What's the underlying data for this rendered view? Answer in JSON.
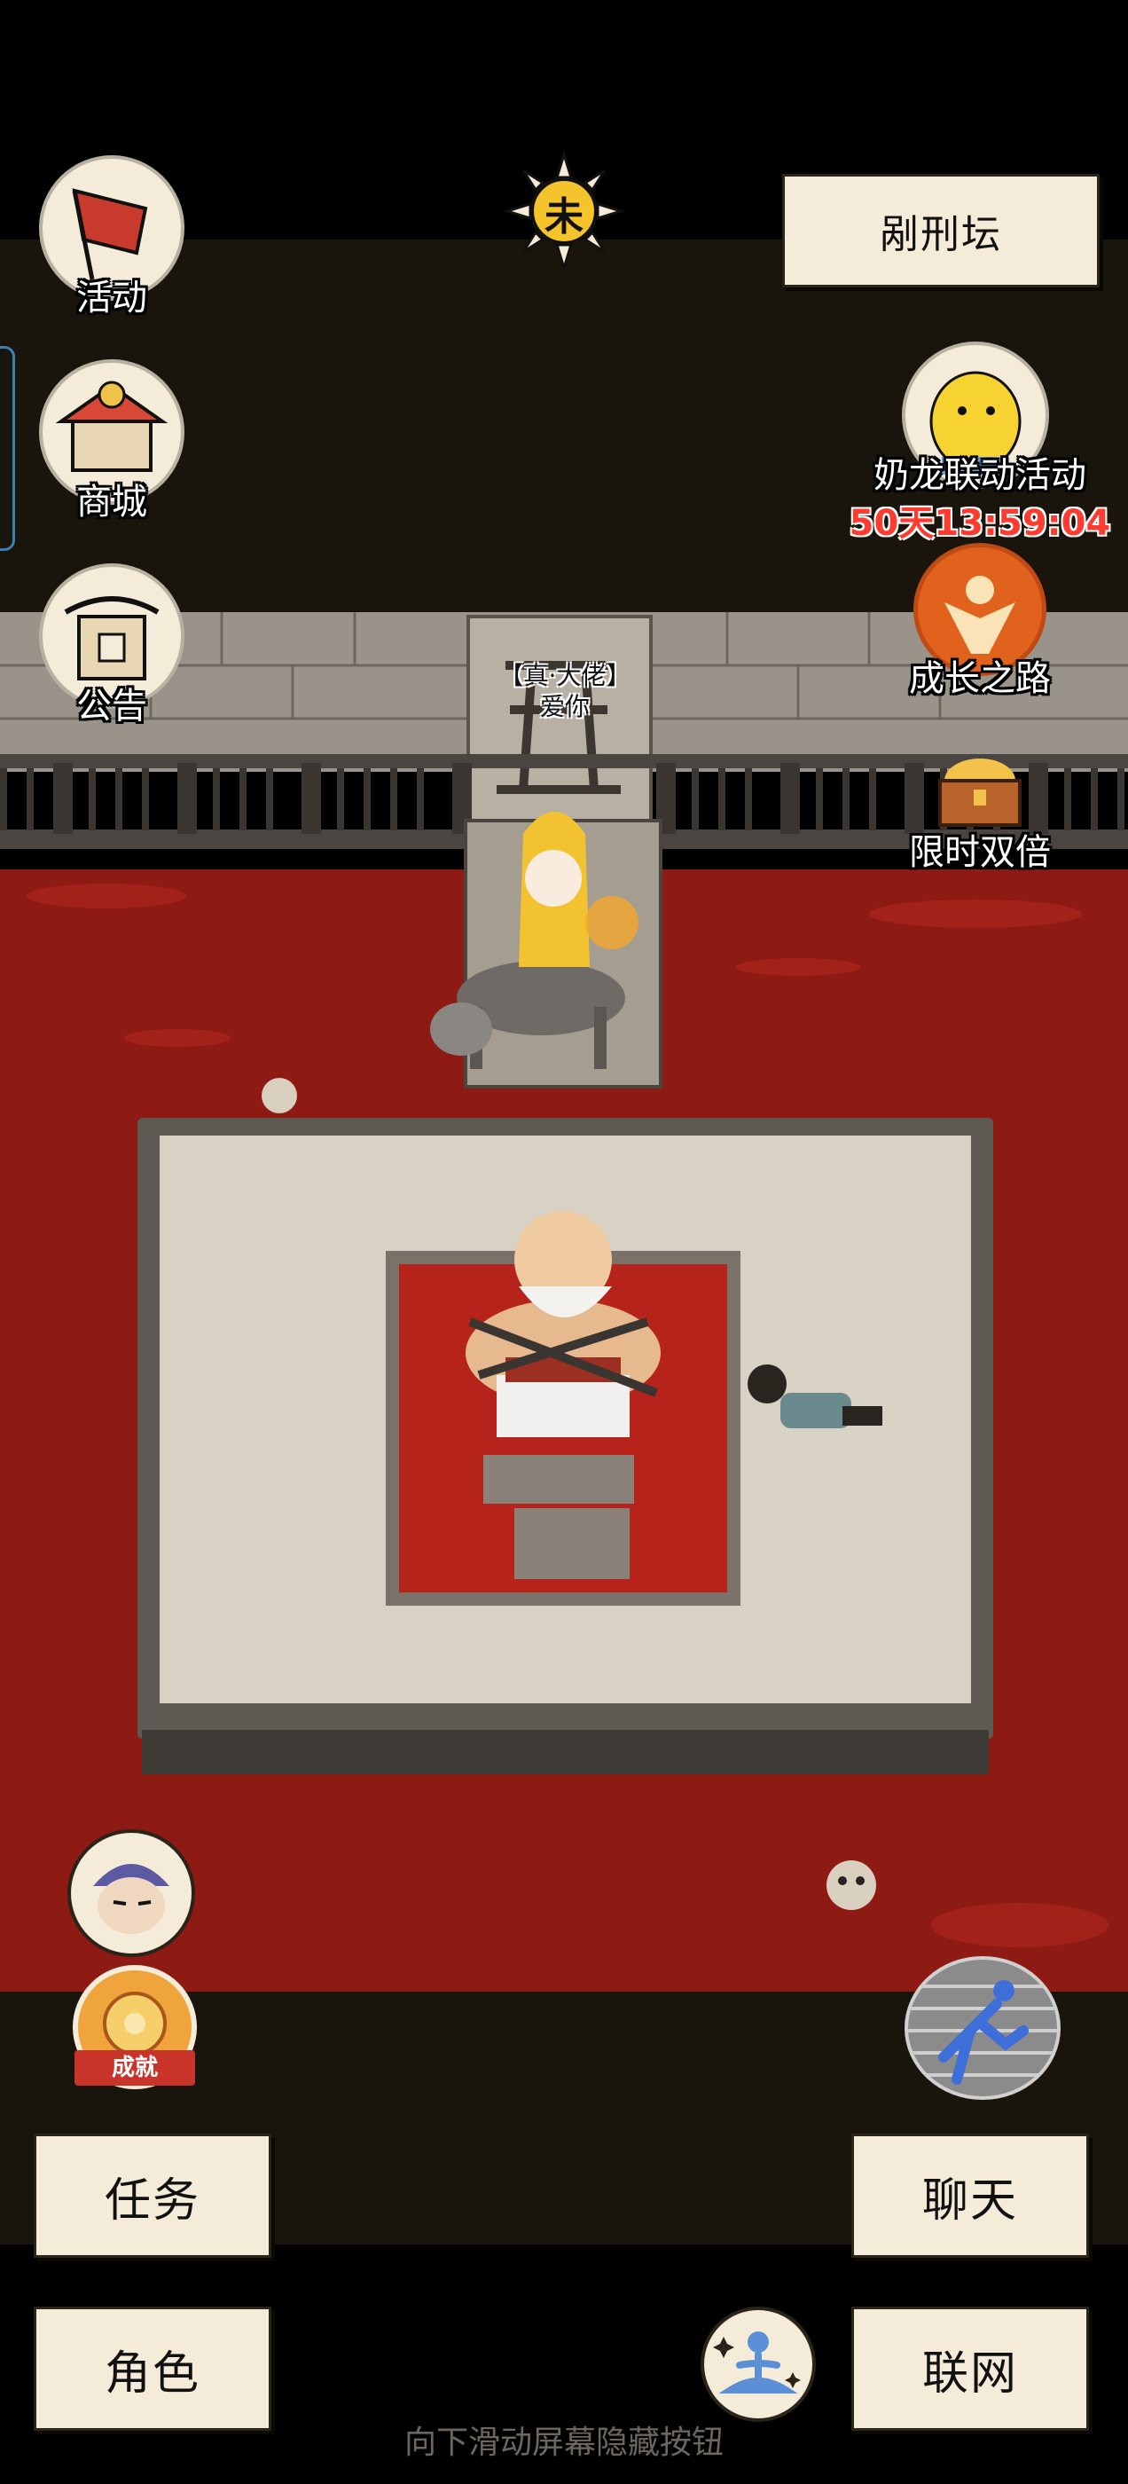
{
  "hud": {
    "time_glyph": "未",
    "location_label": "剐刑坛",
    "left_menu": [
      {
        "label": "活动",
        "icon": "flag-icon"
      },
      {
        "label": "商城",
        "icon": "shop-icon"
      },
      {
        "label": "公告",
        "icon": "notice-board-icon"
      }
    ],
    "right_menu": {
      "collab_label": "奶龙联动活动",
      "collab_timer": "50天13:59:04",
      "growth_label": "成长之路",
      "double_label": "限时双倍"
    },
    "achievement_badge_text": "成就",
    "swipe_hint": "向下滑动屏幕隐藏按钮"
  },
  "scene": {
    "npc_name_title": "【真·大佬】",
    "npc_name": "爱你"
  },
  "buttons": {
    "task": "任务",
    "chat": "聊天",
    "character": "角色",
    "online": "联网"
  },
  "colors": {
    "paper": "#f4ecd8",
    "blood": "#8e1a14",
    "timer_red": "#ff3b30",
    "stone": "#d8d2c4"
  }
}
